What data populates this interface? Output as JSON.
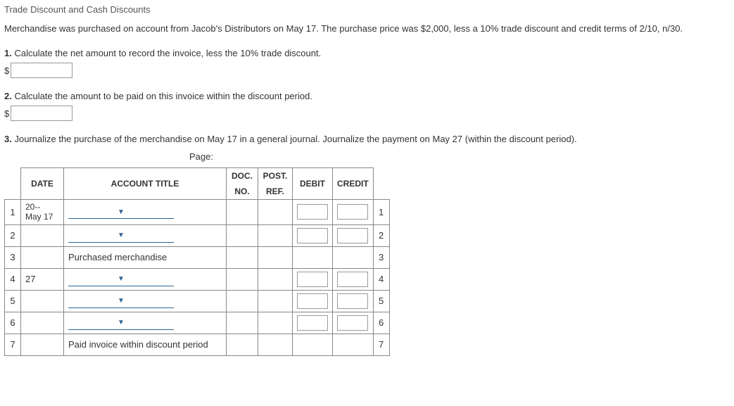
{
  "title": "Trade Discount and Cash Discounts",
  "description": "Merchandise was purchased on account from Jacob's Distributors on May 17. The purchase price was $2,000, less a 10% trade discount and credit terms of 2/10, n/30.",
  "q1": {
    "num": "1.",
    "text": "Calculate the net amount to record the invoice, less the 10% trade discount.",
    "prefix": "$"
  },
  "q2": {
    "num": "2.",
    "text": "Calculate the amount to be paid on this invoice within the discount period.",
    "prefix": "$"
  },
  "q3": {
    "num": "3.",
    "text": "Journalize the purchase of the merchandise on May 17 in a general journal. Journalize the payment on May 27 (within the discount period).",
    "page_label": "Page:"
  },
  "headers": {
    "date": "DATE",
    "title": "ACCOUNT TITLE",
    "doc": "DOC.",
    "no": "NO.",
    "post": "POST.",
    "ref": "REF.",
    "debit": "DEBIT",
    "credit": "CREDIT"
  },
  "rows": {
    "r1": {
      "num": "1",
      "date_top": "20--",
      "date_bot": "May 17"
    },
    "r2": {
      "num": "2"
    },
    "r3": {
      "num": "3",
      "desc": "Purchased merchandise"
    },
    "r4": {
      "num": "4",
      "date": "27"
    },
    "r5": {
      "num": "5"
    },
    "r6": {
      "num": "6"
    },
    "r7": {
      "num": "7",
      "desc": "Paid invoice within discount period"
    }
  }
}
